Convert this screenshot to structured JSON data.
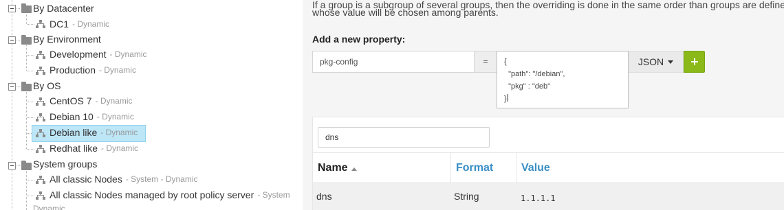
{
  "tree": {
    "categories": [
      {
        "label": "By Datacenter",
        "groups": [
          {
            "name": "DC1",
            "tag": "- Dynamic"
          }
        ]
      },
      {
        "label": "By Environment",
        "groups": [
          {
            "name": "Development",
            "tag": "- Dynamic"
          },
          {
            "name": "Production",
            "tag": "- Dynamic"
          }
        ]
      },
      {
        "label": "By OS",
        "groups": [
          {
            "name": "CentOS 7",
            "tag": "- Dynamic"
          },
          {
            "name": "Debian 10",
            "tag": "- Dynamic"
          },
          {
            "name": "Debian like",
            "tag": "- Dynamic",
            "selected": true
          },
          {
            "name": "Redhat like",
            "tag": "- Dynamic"
          }
        ]
      },
      {
        "label": "System groups",
        "groups": [
          {
            "name": "All classic Nodes",
            "tag": "- System - Dynamic"
          },
          {
            "name": "All classic Nodes managed by root policy server",
            "tag": "- System",
            "tag_continued": "Dynamic"
          }
        ]
      }
    ]
  },
  "panel": {
    "intro_line1": "If a group is a subgroup of several groups, then the overriding is done in the same order than groups are defined",
    "intro_line2": "whose value will be chosen among parents.",
    "add_title": "Add a new property:",
    "key_value": "pkg-config",
    "equals": "=",
    "value_lines": [
      "{",
      "  \"path\": \"/debian\",",
      "  \"pkg\" : \"deb\"",
      "}"
    ],
    "format_label": "JSON",
    "filter_value": "dns",
    "columns": {
      "name": "Name",
      "format": "Format",
      "value": "Value"
    },
    "rows": [
      {
        "name": "dns",
        "format": "String",
        "value": "1.1.1.1"
      }
    ]
  },
  "colors": {
    "accent_green": "#8ab919",
    "link_blue": "#3a8fc6",
    "selection": "#bde6f7"
  }
}
